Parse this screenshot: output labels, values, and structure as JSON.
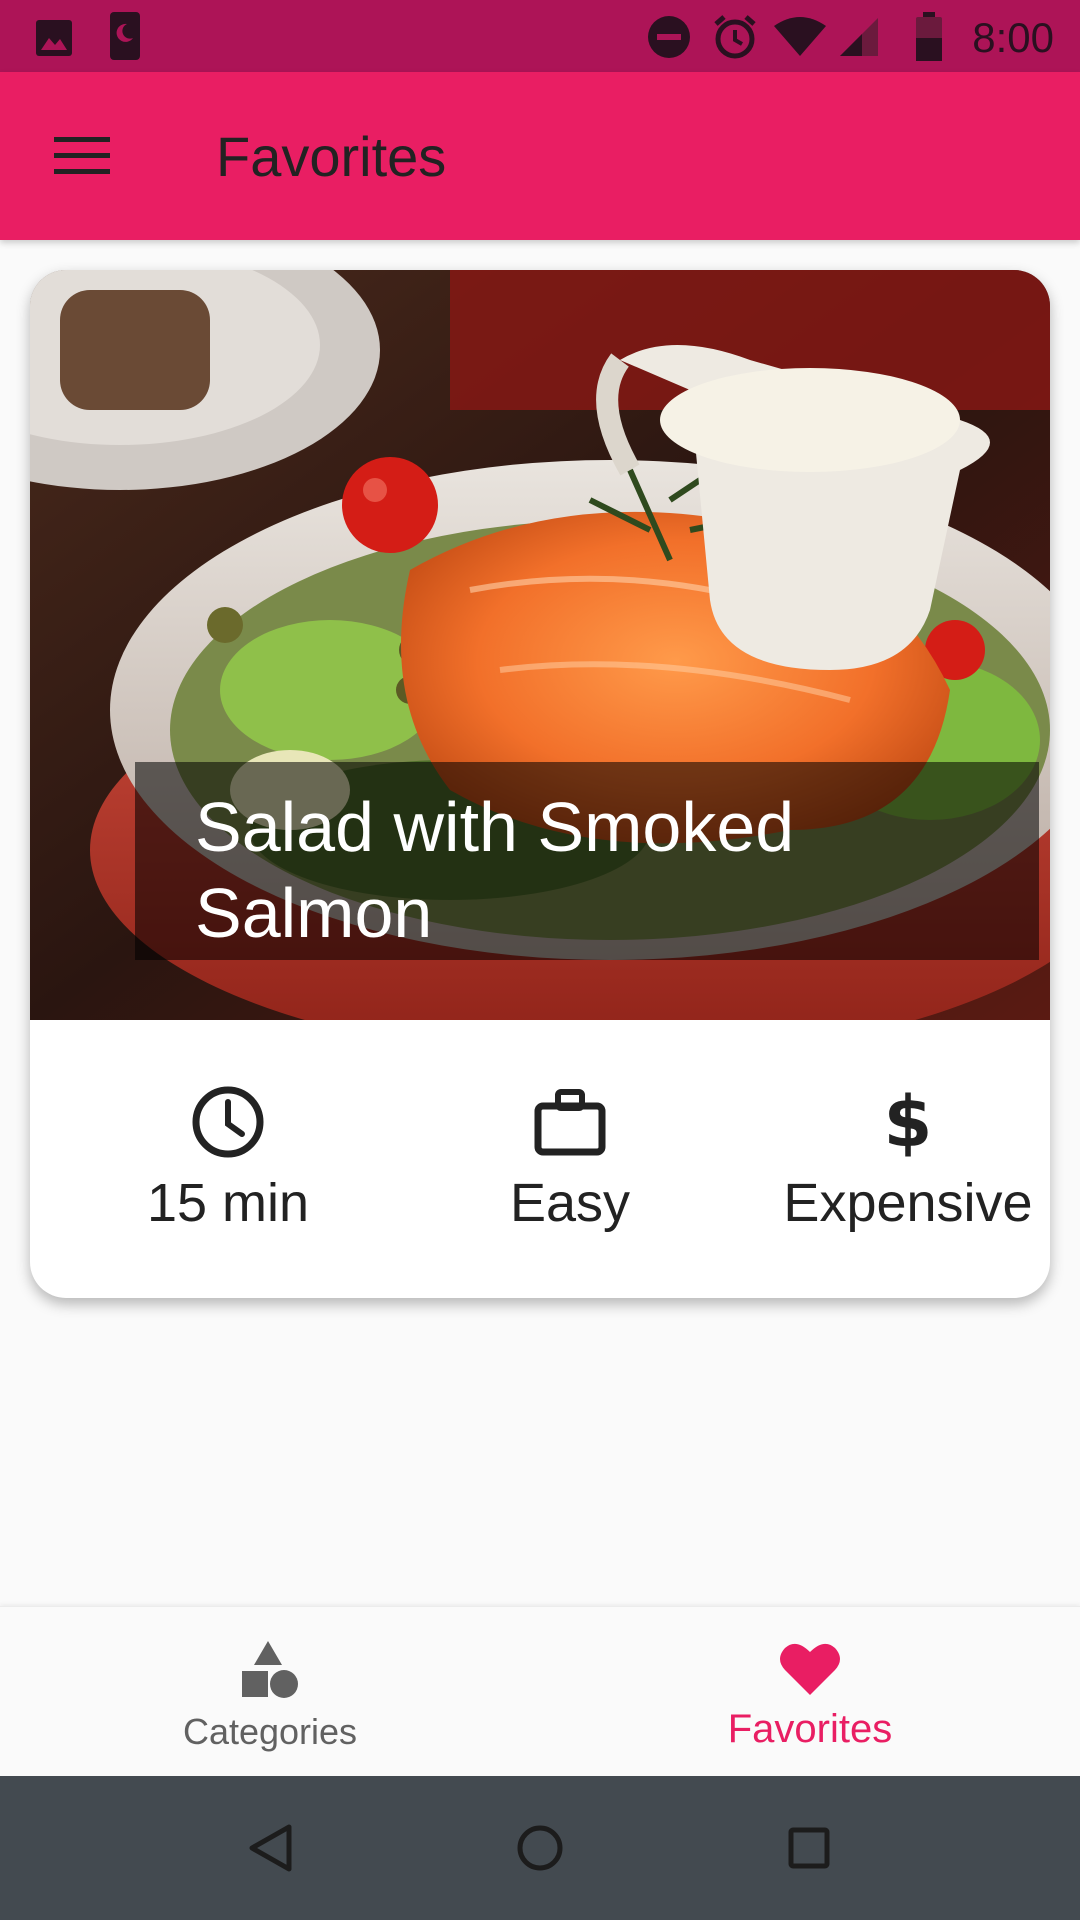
{
  "status_bar": {
    "time": "8:00",
    "left_icons": [
      "image-icon",
      "moon-phone-icon"
    ],
    "right_icons": [
      "do-not-disturb-icon",
      "alarm-icon",
      "wifi-icon",
      "cell-signal-icon",
      "battery-icon"
    ]
  },
  "app_bar": {
    "title": "Favorites",
    "menu_icon": "hamburger-menu-icon"
  },
  "meals": [
    {
      "title": "Salad with Smoked Salmon",
      "image": "smoked-salmon-salad-photo",
      "duration": "15 min",
      "complexity": "Easy",
      "affordability": "Expensive",
      "icons": {
        "duration": "clock-icon",
        "complexity": "briefcase-icon",
        "affordability": "dollar-icon"
      }
    }
  ],
  "bottom_nav": {
    "tabs": [
      {
        "label": "Categories",
        "icon": "shapes-icon",
        "active": false
      },
      {
        "label": "Favorites",
        "icon": "heart-icon",
        "active": true
      }
    ]
  },
  "system_nav": {
    "buttons": [
      "back-icon",
      "home-icon",
      "recents-icon"
    ]
  },
  "colors": {
    "status_bar": "#ad1457",
    "primary": "#e91e63",
    "active_tab": "#e91e63",
    "inactive_tab": "#616161",
    "background": "#fafafa",
    "system_nav": "#434a50"
  }
}
